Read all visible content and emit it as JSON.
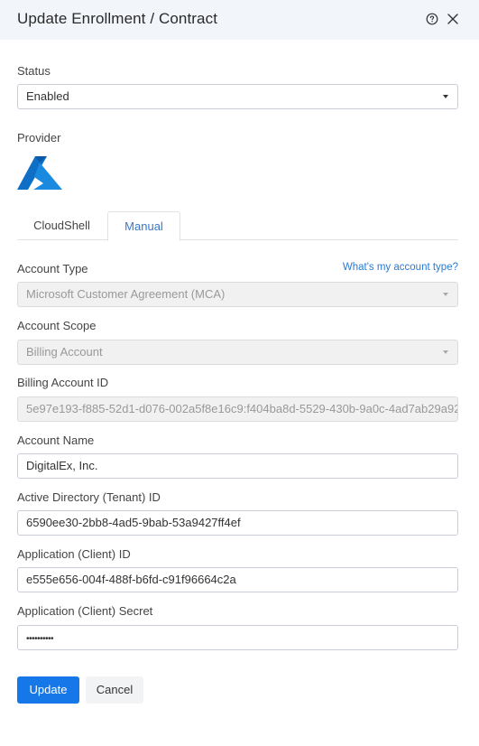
{
  "header": {
    "title": "Update Enrollment / Contract"
  },
  "status": {
    "label": "Status",
    "value": "Enabled"
  },
  "provider": {
    "label": "Provider"
  },
  "tabs": [
    {
      "label": "CloudShell",
      "active": false
    },
    {
      "label": "Manual",
      "active": true
    }
  ],
  "form": {
    "account_type": {
      "label": "Account Type",
      "help_link": "What's my account type?",
      "value": "Microsoft Customer Agreement (MCA)"
    },
    "account_scope": {
      "label": "Account Scope",
      "value": "Billing Account"
    },
    "billing_account_id": {
      "label": "Billing Account ID",
      "value": "5e97e193-f885-52d1-d076-002a5f8e16c9:f404ba8d-5529-430b-9a0c-4ad7ab29a92"
    },
    "account_name": {
      "label": "Account Name",
      "value": "DigitalEx, Inc."
    },
    "tenant_id": {
      "label": "Active Directory (Tenant) ID",
      "value": "6590ee30-2bb8-4ad5-9bab-53a9427ff4ef"
    },
    "client_id": {
      "label": "Application (Client) ID",
      "value": "e555e656-004f-488f-b6fd-c91f96664c2a"
    },
    "client_secret": {
      "label": "Application (Client) Secret",
      "value": "••••••••••"
    }
  },
  "buttons": {
    "update": "Update",
    "cancel": "Cancel"
  },
  "colors": {
    "header_bg": "#f2f5fa",
    "primary": "#1677e8",
    "link": "#2a7ad1",
    "azure_blue": "#0078d4"
  },
  "icons": {
    "help": "help-circle-icon",
    "close": "close-icon",
    "provider": "azure-logo",
    "dropdown": "caret-down-icon"
  }
}
